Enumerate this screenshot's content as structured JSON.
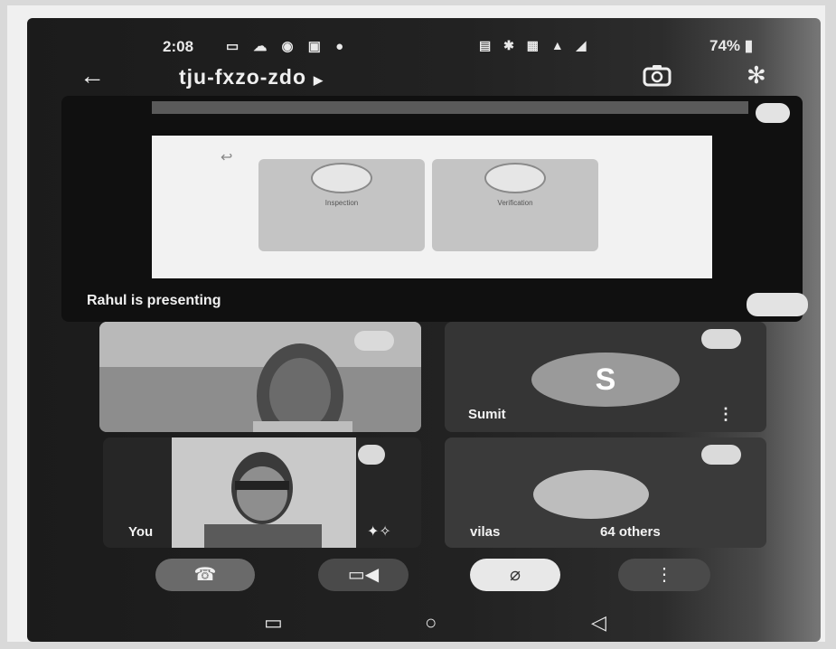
{
  "status_bar": {
    "time": "2:08",
    "left_icons": [
      "messages-icon",
      "cloud-icon",
      "jio-icon",
      "wallet-icon",
      "location-icon"
    ],
    "battery": "74%"
  },
  "header": {
    "meeting_code": "tju-fxzo-zdo"
  },
  "presentation": {
    "presenting_text": "Rahul is presenting",
    "slide": {
      "cards": [
        {
          "title": "Inspection",
          "icon": "magnifier-icon"
        },
        {
          "title": "Verification",
          "icon": "check-icon"
        }
      ]
    }
  },
  "participants": [
    {
      "name": "",
      "type": "video",
      "pinned": true
    },
    {
      "name": "Sumit",
      "type": "avatar",
      "initial": "S"
    },
    {
      "name": "You",
      "type": "video"
    },
    {
      "name": "vilas",
      "type": "photo",
      "others_label": "64 others"
    }
  ],
  "controls": {
    "end_call": "end-call-icon",
    "camera": "video-camera-icon",
    "mic": "mic-off-icon",
    "more": "more-options-icon"
  },
  "colors": {
    "tile_bg": "#2e2e2e",
    "screen_bg": "#1b1b1b"
  }
}
